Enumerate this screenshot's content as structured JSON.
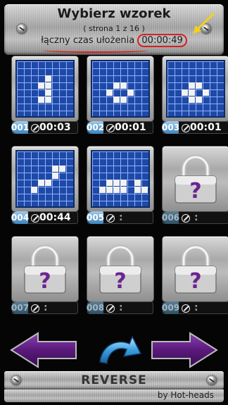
{
  "header": {
    "title": "Wybierz wzorek",
    "subtitle": "( strona 1 z 16 )",
    "total_time_label": "łączny czas ułożenia",
    "total_time_value": "00:00:49"
  },
  "levels": [
    {
      "number": "001",
      "time": "00:03",
      "locked": false
    },
    {
      "number": "002",
      "time": "00:01",
      "locked": false
    },
    {
      "number": "003",
      "time": "00:01",
      "locked": false
    },
    {
      "number": "004",
      "time": "00:44",
      "locked": false
    },
    {
      "number": "005",
      "time": ":",
      "locked": false
    },
    {
      "number": "006",
      "time": ":",
      "locked": true
    },
    {
      "number": "007",
      "time": ":",
      "locked": true
    },
    {
      "number": "008",
      "time": ":",
      "locked": true
    },
    {
      "number": "009",
      "time": ":",
      "locked": true
    }
  ],
  "nav": {
    "reverse_label": "REVERSE",
    "credit": "by Hot-heads"
  },
  "colors": {
    "board_blue": "#1e49a6",
    "arrow_purple": "#5a1a7a",
    "badge_blue": "#3e84bd",
    "annotation_red": "#d62222",
    "annotation_yellow": "#f3d21a"
  },
  "icons": [
    "screw-icon",
    "clock-icon",
    "padlock-icon",
    "left-arrow-icon",
    "right-arrow-icon",
    "reverse-arrow-icon"
  ]
}
